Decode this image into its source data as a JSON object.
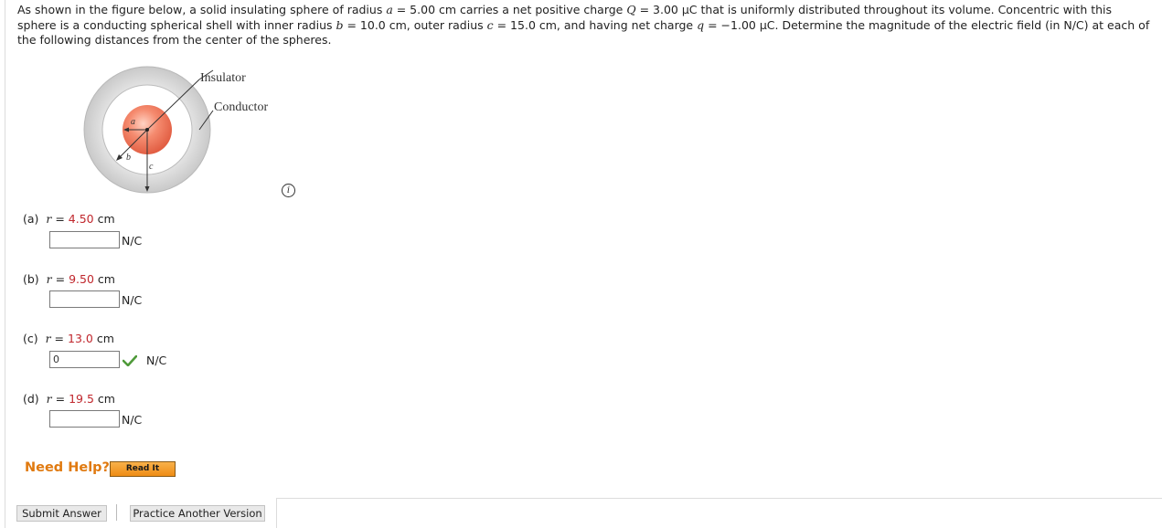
{
  "problem": {
    "s1": "As shown in the figure below, a solid insulating sphere of radius ",
    "var_a": "a",
    "s2": " = 5.00 cm carries a net positive charge ",
    "var_Q": "Q",
    "s3": " = 3.00 μC that is uniformly distributed throughout its volume. Concentric with this sphere is a conducting spherical shell with inner radius ",
    "var_b": "b",
    "s4": " = 10.0 cm, outer radius ",
    "var_c": "c",
    "s5": " = 15.0 cm, and having net charge ",
    "var_q": "q",
    "s6": " = −1.00 μC. Determine the magnitude of the electric field (in N/C) at each of the following distances from the center of the spheres."
  },
  "figure": {
    "insulator_label": "Insulator",
    "conductor_label": "Conductor",
    "letter_a": "a",
    "letter_b": "b",
    "letter_c": "c",
    "colors": {
      "shell": "#d6d6d6",
      "sphere": "#ec6a4e"
    }
  },
  "info_icon": "i",
  "parts": [
    {
      "label": "(a)",
      "var": "r",
      "eq": " = ",
      "value": "4.50",
      "unit_text": " cm",
      "answer": "",
      "answer_unit": "N/C"
    },
    {
      "label": "(b)",
      "var": "r",
      "eq": " = ",
      "value": "9.50",
      "unit_text": " cm",
      "answer": "",
      "answer_unit": "N/C"
    },
    {
      "label": "(c)",
      "var": "r",
      "eq": " = ",
      "value": "13.0",
      "unit_text": " cm",
      "answer": "0",
      "answer_unit": "N/C",
      "status": "correct"
    },
    {
      "label": "(d)",
      "var": "r",
      "eq": " = ",
      "value": "19.5",
      "unit_text": " cm",
      "answer": "",
      "answer_unit": "N/C"
    }
  ],
  "help": {
    "need_help": "Need Help?",
    "read_it": "Read It"
  },
  "buttons": {
    "submit": "Submit Answer",
    "practice": "Practice Another Version"
  },
  "colors": {
    "accent_red": "#c0272d",
    "help_orange": "#e07a10",
    "check_green": "#4f9a3a"
  }
}
